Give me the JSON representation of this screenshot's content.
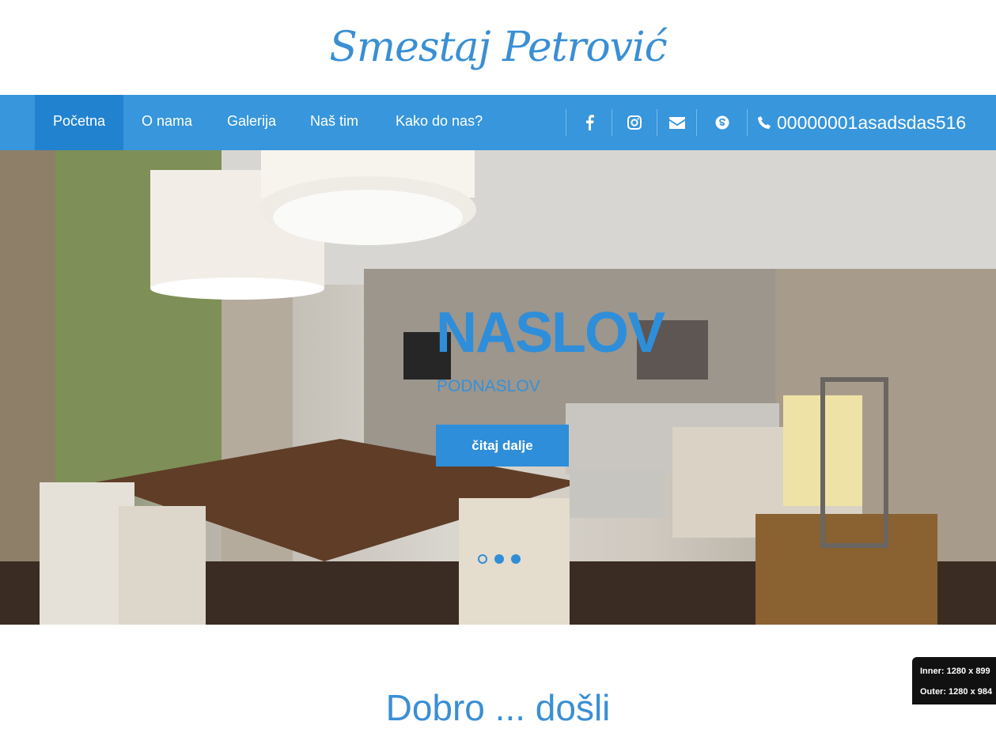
{
  "header": {
    "logo": "Smestaj Petrović"
  },
  "nav": {
    "items": [
      {
        "label": "Početna",
        "active": true
      },
      {
        "label": "O nama"
      },
      {
        "label": "Galerija"
      },
      {
        "label": "Naš tim"
      },
      {
        "label": "Kako do nas?"
      }
    ],
    "social": [
      "facebook-icon",
      "instagram-icon",
      "envelope-icon",
      "skype-icon"
    ],
    "phone": "00000001asadsdas516"
  },
  "hero": {
    "title": "NASLOV",
    "subtitle": "PODNASLOV",
    "button": "čitaj dalje",
    "slides": 3,
    "active_slide": 1
  },
  "section": {
    "title": "Dobro ... došli"
  },
  "viewport": {
    "inner": "Inner: 1280 x 899",
    "outer": "Outer: 1280 x 984"
  },
  "colors": {
    "primary": "#3796dc",
    "active": "#2182cf"
  }
}
